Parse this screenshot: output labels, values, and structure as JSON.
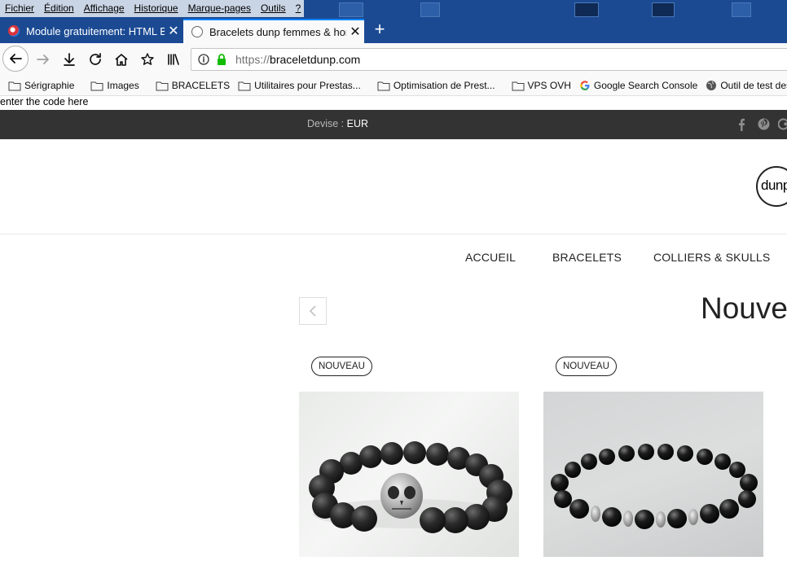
{
  "menu": {
    "items": [
      "Fichier",
      "Édition",
      "Affichage",
      "Historique",
      "Marque-pages",
      "Outils",
      "?"
    ]
  },
  "tabs": [
    {
      "title": "Module gratuitement: HTML Bo",
      "active": false
    },
    {
      "title": "Bracelets dunp femmes & hom",
      "active": true
    }
  ],
  "urlbar": {
    "protocol": "https://",
    "host": "braceletdunp.com"
  },
  "bookmarks": [
    {
      "label": "Sérigraphie",
      "icon": "folder-icon"
    },
    {
      "label": "Images",
      "icon": "folder-icon"
    },
    {
      "label": "BRACELETS",
      "icon": "folder-icon"
    },
    {
      "label": "Utilitaires pour Prestas...",
      "icon": "folder-icon"
    },
    {
      "label": "Optimisation de Prest...",
      "icon": "folder-icon"
    },
    {
      "label": "VPS OVH",
      "icon": "folder-icon"
    },
    {
      "label": "Google Search Console",
      "icon": "google-icon"
    },
    {
      "label": "Outil de test des do",
      "icon": "globe-icon"
    }
  ],
  "page": {
    "code_note": "enter the code here",
    "topbar": {
      "devise_label": "Devise :",
      "devise_value": "EUR"
    },
    "logo_text": "dunp",
    "nav": [
      "ACCUEIL",
      "BRACELETS",
      "COLLIERS & SKULLS"
    ],
    "section_title": "Nouvea",
    "products": [
      {
        "badge": "NOUVEAU"
      },
      {
        "badge": "NOUVEAU"
      }
    ]
  },
  "colors": {
    "browser_chrome": "#1b4a93",
    "active_tab_accent": "#0a84ff",
    "lock_green": "#12bc00",
    "site_topbar": "#333333"
  }
}
